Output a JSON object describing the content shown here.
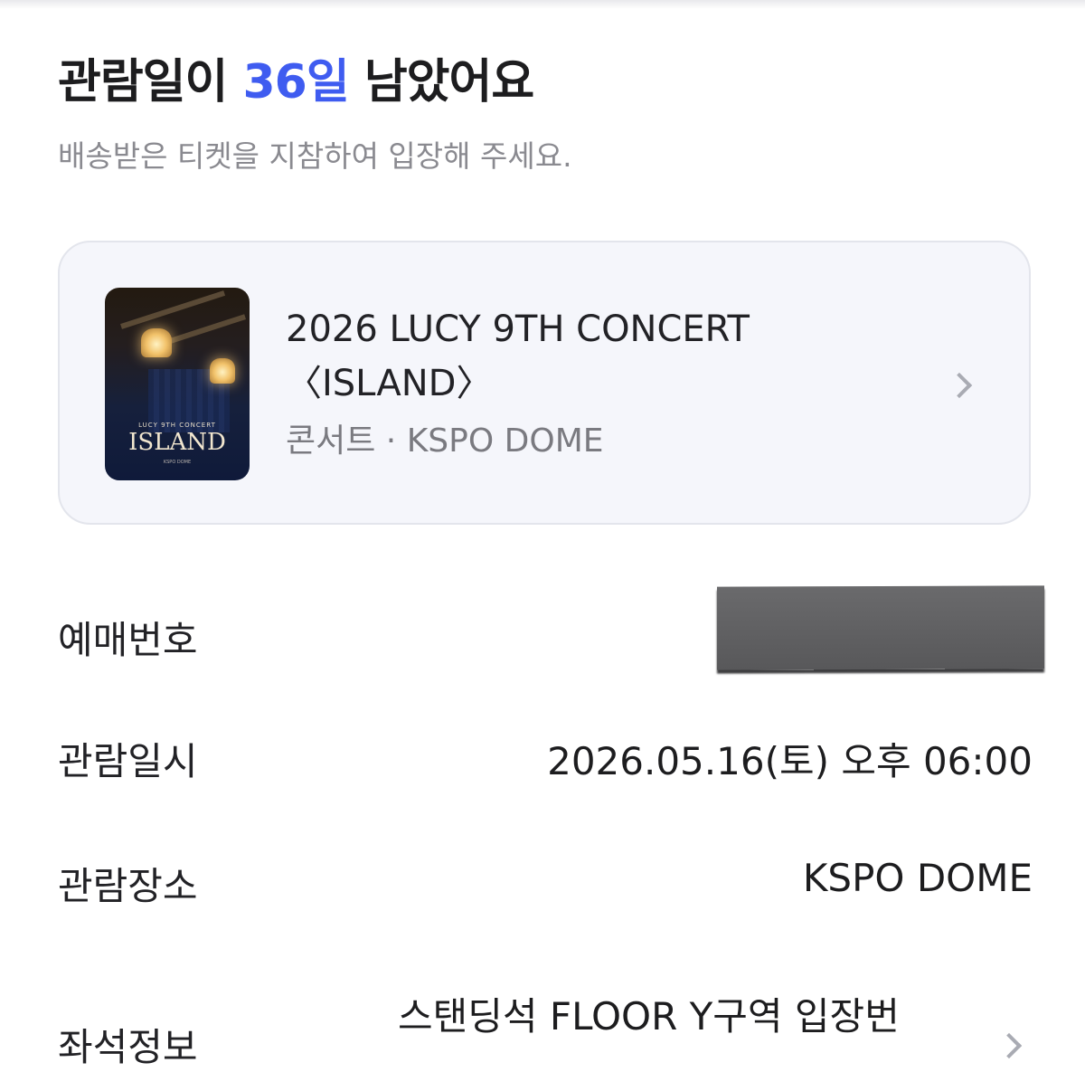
{
  "header": {
    "title_prefix": "관람일이",
    "title_days": "36일",
    "title_suffix": "남았어요",
    "subtitle": "배송받은 티켓을 지참하여 입장해 주세요."
  },
  "event": {
    "title_line1": "2026 LUCY 9TH CONCERT",
    "title_line2": "〈ISLAND〉",
    "meta": "콘서트 · KSPO DOME",
    "poster": {
      "subtitle": "LUCY 9TH CONCERT",
      "title": "ISLAND",
      "meta": "KSPO DOME"
    }
  },
  "details": {
    "reservation_label": "예매번호",
    "date_label": "관람일시",
    "date_value": "2026.05.16(토) 오후 06:00",
    "venue_label": "관람장소",
    "venue_value": "KSPO DOME",
    "seat_label": "좌석정보",
    "seat_value": "스탠딩석 FLOOR Y구역 입장번"
  },
  "colors": {
    "accent": "#3f5cf0",
    "card_bg": "#f5f6fb",
    "muted_text": "#8a8a90"
  },
  "icons": {
    "card_chevron": "chevron-right-icon",
    "seat_chevron": "chevron-right-icon"
  }
}
